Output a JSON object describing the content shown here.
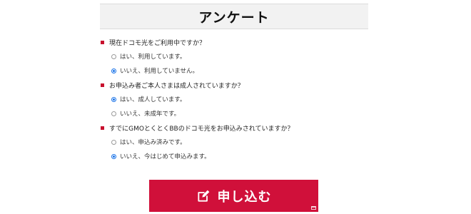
{
  "header": {
    "title": "アンケート"
  },
  "questions": [
    {
      "label": "現在ドコモ光をご利用中ですか？",
      "options": [
        {
          "label": "はい、利用しています。",
          "checked": false
        },
        {
          "label": "いいえ、利用していません。",
          "checked": true
        }
      ]
    },
    {
      "label": "お申込み者ご本人さまは成人されていますか？",
      "options": [
        {
          "label": "はい、成人しています。",
          "checked": true
        },
        {
          "label": "いいえ、未成年です。",
          "checked": false
        }
      ]
    },
    {
      "label": "すでにGMOとくとくBBのドコモ光をお申込みされていますか？",
      "options": [
        {
          "label": "はい、申込み済みです。",
          "checked": false
        },
        {
          "label": "いいえ、今はじめて申込みます。",
          "checked": true
        }
      ]
    }
  ],
  "submit": {
    "label": "申し込む",
    "icon": "edit-icon"
  },
  "colors": {
    "accent": "#d0103a",
    "bullet": "#c8102e",
    "radio_checked": "#1a73e8"
  }
}
